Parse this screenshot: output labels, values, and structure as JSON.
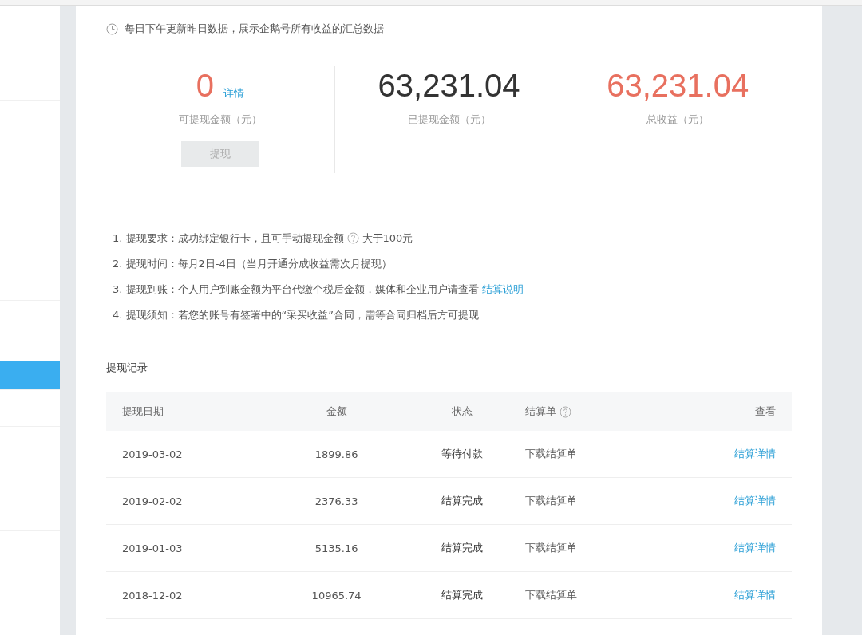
{
  "sidebar": {
    "items": [
      {
        "selected": false
      },
      {
        "selected": false
      },
      {
        "selected": false
      },
      {
        "selected": true
      },
      {
        "selected": false
      },
      {
        "selected": false
      }
    ]
  },
  "notice": "每日下午更新昨日数据，展示企鹅号所有收益的汇总数据",
  "stats": [
    {
      "value": "0",
      "label": "可提现金额（元）",
      "link": "详情",
      "button": {
        "label": "提现",
        "disabled": true
      },
      "color": "#e8705f"
    },
    {
      "value": "63,231.04",
      "label": "已提现金额（元）",
      "color": "#333333"
    },
    {
      "value": "63,231.04",
      "label": "总收益（元）",
      "color": "#e8705f"
    }
  ],
  "rules": [
    {
      "text": "1. 提现要求：成功绑定银行卡，且可手动提现金额",
      "help": true,
      "after": "大于100元"
    },
    {
      "text": "2. 提现时间：每月2日-4日（当月开通分成收益需次月提现）"
    },
    {
      "text": "3. 提现到账：个人用户到账金额为平台代缴个税后金额，媒体和企业用户请查看",
      "link": "结算说明"
    },
    {
      "text": "4. 提现须知：若您的账号有签署中的“采买收益”合同，需等合同归档后方可提现"
    }
  ],
  "records": {
    "title": "提现记录",
    "columns": [
      {
        "label": "提现日期"
      },
      {
        "label": "金额"
      },
      {
        "label": "状态"
      },
      {
        "label": "结算单",
        "help": true
      },
      {
        "label": "查看"
      }
    ],
    "rows": [
      {
        "date": "2019-03-02",
        "amount": "1899.86",
        "status": "等待付款",
        "statement": "下载结算单",
        "detail": "结算详情"
      },
      {
        "date": "2019-02-02",
        "amount": "2376.33",
        "status": "结算完成",
        "statement": "下载结算单",
        "detail": "结算详情"
      },
      {
        "date": "2019-01-03",
        "amount": "5135.16",
        "status": "结算完成",
        "statement": "下载结算单",
        "detail": "结算详情"
      },
      {
        "date": "2018-12-02",
        "amount": "10965.74",
        "status": "结算完成",
        "statement": "下载结算单",
        "detail": "结算详情"
      }
    ]
  }
}
